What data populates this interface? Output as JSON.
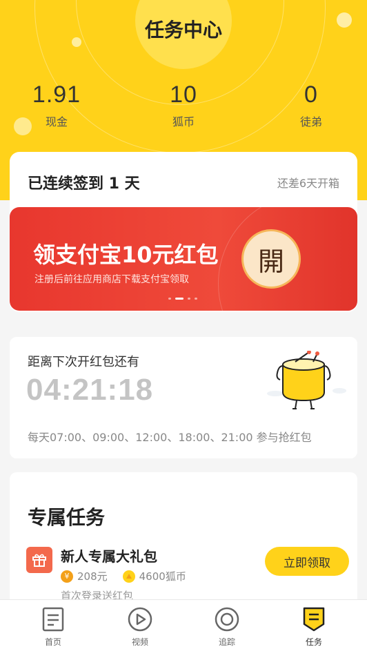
{
  "header": {
    "title": "任务中心",
    "stats": [
      {
        "value": "1.91",
        "label": "现金"
      },
      {
        "value": "10",
        "label": "狐币"
      },
      {
        "value": "0",
        "label": "徒弟"
      }
    ]
  },
  "checkin": {
    "title": "已连续签到 1 天",
    "right_text": "还差6天开箱"
  },
  "banner": {
    "title": "领支付宝10元红包",
    "subtitle": "注册后前往应用商店下载支付宝领取",
    "open_label": "開"
  },
  "countdown": {
    "label": "距离下次开红包还有",
    "time": "04:21:18",
    "schedule": "每天07:00、09:00、12:00、18:00、21:00 参与抢红包"
  },
  "tasks": {
    "title": "专属任务",
    "items": [
      {
        "name": "新人专属大礼包",
        "cash": "208元",
        "coins": "4600狐币",
        "desc": "首次登录送红包",
        "button": "立即领取"
      }
    ]
  },
  "nav": {
    "items": [
      {
        "label": "首页",
        "icon": "home-icon"
      },
      {
        "label": "视频",
        "icon": "video-icon"
      },
      {
        "label": "追踪",
        "icon": "track-icon"
      },
      {
        "label": "任务",
        "icon": "task-icon"
      }
    ]
  },
  "colors": {
    "brand_yellow": "#ffd21a",
    "banner_red": "#e8372e",
    "coin_orange": "#f3a019"
  }
}
